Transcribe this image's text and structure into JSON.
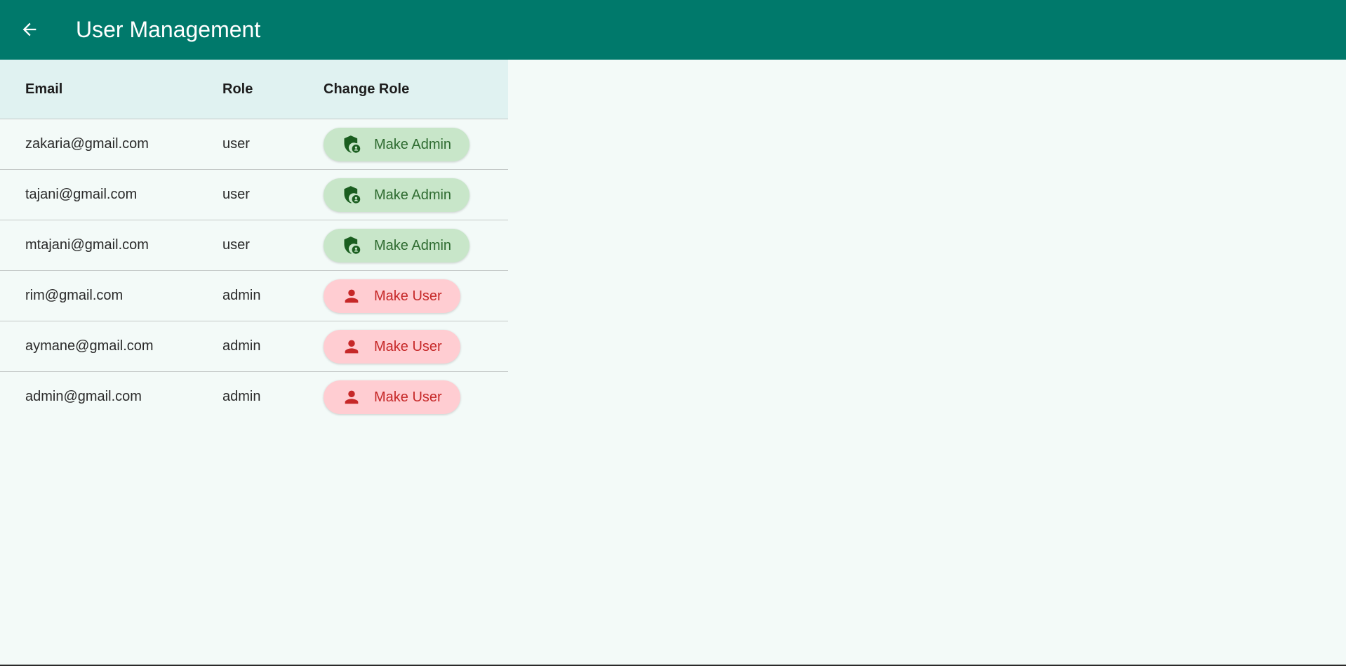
{
  "appbar": {
    "title": "User Management",
    "back_icon": "arrow-back-icon",
    "color": "#00796b"
  },
  "table": {
    "headers": {
      "email": "Email",
      "role": "Role",
      "action": "Change Role"
    },
    "rows": [
      {
        "email": "zakaria@gmail.com",
        "role": "user",
        "action": "Make Admin",
        "action_type": "admin",
        "icon": "admin-shield-icon"
      },
      {
        "email": "tajani@gmail.com",
        "role": "user",
        "action": "Make Admin",
        "action_type": "admin",
        "icon": "admin-shield-icon"
      },
      {
        "email": "mtajani@gmail.com",
        "role": "user",
        "action": "Make Admin",
        "action_type": "admin",
        "icon": "admin-shield-icon"
      },
      {
        "email": "rim@gmail.com",
        "role": "admin",
        "action": "Make User",
        "action_type": "user",
        "icon": "person-icon"
      },
      {
        "email": "aymane@gmail.com",
        "role": "admin",
        "action": "Make User",
        "action_type": "user",
        "icon": "person-icon"
      },
      {
        "email": "admin@gmail.com",
        "role": "admin",
        "action": "Make User",
        "action_type": "user",
        "icon": "person-icon"
      }
    ]
  },
  "colors": {
    "header_bg": "#e0f2f1",
    "make_admin_bg": "#c8e6c9",
    "make_admin_fg": "#2e6b30",
    "make_user_bg": "#ffcdd2",
    "make_user_fg": "#c62828"
  }
}
